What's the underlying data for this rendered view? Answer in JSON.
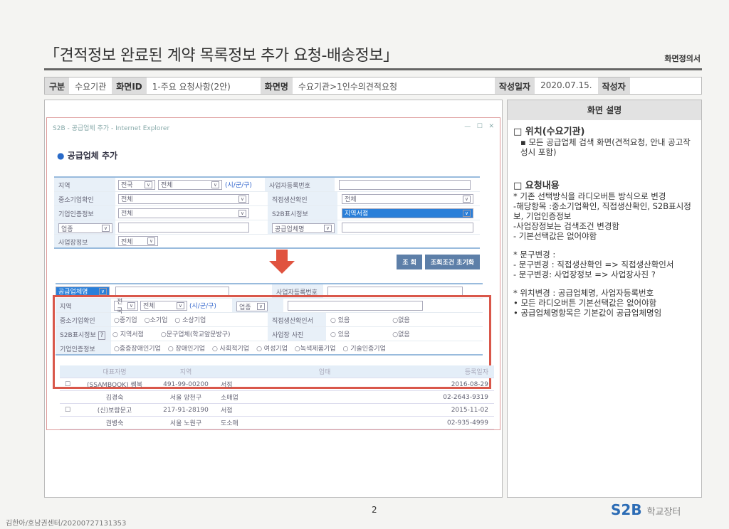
{
  "header": {
    "title": "「견적정보 완료된 계약 목록정보 추가 요청-배송정보」",
    "doc_type": "화면정의서"
  },
  "info": {
    "k1": "구분",
    "v1": "수요기관",
    "k2": "화면ID",
    "v2": "1-주요 요청사항(2안)",
    "k3": "화면명",
    "v3": "수요기관>1인수의견적요청",
    "k4": "작성일자",
    "v4": "2020.07.15.",
    "k5": "작성자",
    "v5": ""
  },
  "popup": {
    "window_title": "S2B - 공급업체 추가 - Internet Explorer",
    "heading": "공급업체 추가",
    "old": {
      "region": "지역",
      "nation": "전국",
      "all": "전체",
      "sigungu": "(시/군/구)",
      "bizno": "사업자등록번호",
      "sme": "중소기업확인",
      "direct": "직접생산확인",
      "cert": "기업인증정보",
      "s2b": "S2B표시정보",
      "s2b_val": "지역서점",
      "industry": "업종",
      "supplier": "공급업체명",
      "site": "사업장정보",
      "search": "조 회",
      "reset": "조회조건 초기화"
    },
    "new": {
      "supplier": "공급업체명",
      "bizno": "사업자등록번호",
      "region": "지역",
      "nation": "전국",
      "all": "전체",
      "sigungu": "(시/군/구)",
      "industry": "업종",
      "sme": "중소기업확인",
      "sme_opts": [
        "중기업",
        "소기업",
        "소상기업"
      ],
      "direct": "직접생산확인서",
      "yes": "있음",
      "no": "없음",
      "s2b": "S2B표시정보",
      "s2b_opts": [
        "지역서점",
        "문구업체(학교앞문방구)"
      ],
      "photo": "사업장 사진",
      "cert": "기업인증정보",
      "cert_opts": [
        "중증장애인기업",
        "장애인기업",
        "사회적기업",
        "여성기업",
        "녹색제품기업",
        "기술인증기업"
      ]
    },
    "table": {
      "headers": [
        "대표자명",
        "지역",
        "업태",
        "등록일자"
      ],
      "rows": [
        {
          "name": "(SSAMBOOK) 쌤북",
          "bizno": "491-99-00200",
          "type": "서점",
          "date": "2016-08-29",
          "rep": "김경숙",
          "area": "서울 양천구",
          "type2": "소매업",
          "phone": "02-2643-9319"
        },
        {
          "name": "(신)보람문고",
          "bizno": "217-91-28190",
          "type": "서점",
          "date": "2015-11-02",
          "rep": "권병숙",
          "area": "서울 노원구",
          "type2": "도소매",
          "phone": "02-935-4999"
        }
      ]
    }
  },
  "desc": {
    "title": "화면 설명",
    "sec1": "□ 위치(수요기관)",
    "sec1_items": [
      "▪ 모든 공급업체 검색 화면(견적요청, 안내 공고작성시 포함)"
    ],
    "sec2": "□ 요청내용",
    "lines": [
      "* 기존 선택방식을 라디오버튼 방식으로 변경",
      "-해당항목 :중소기업확인, 직접생산확인, S2B표시정보, 기업인증정보",
      "-사업장정보는 검색조건 변경함",
      "- 기본선택값은 없어야함",
      "",
      "* 문구변경 :",
      "- 문구변경 : 직접생산확인 => 직접생산확인서",
      "- 문구변경: 사업장정보 =>  사업장사진 ?",
      "",
      "* 위치변경 : 공급업체명, 사업자등록번호",
      "•  모든 라디오버튼 기본선택값은 없어야함",
      "•  공급업체명항목은 기본값이 공급업체명임"
    ]
  },
  "footer": {
    "page": "2",
    "logo": "S2B",
    "logo_sub": "학교장터",
    "author": "김한아/호남권센터/20200727131353"
  }
}
